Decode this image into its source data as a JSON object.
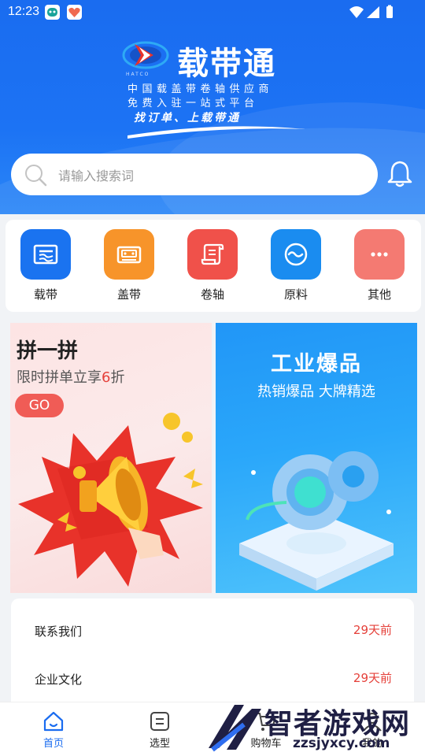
{
  "status_bar": {
    "time": "12:23"
  },
  "header": {
    "brand_name": "载带通",
    "logo_sub": "HATCO",
    "tagline_line1": "中国载盖带卷轴供应商",
    "tagline_line2": "免费入驻一站式平台",
    "slogan": "找订单、上载带通"
  },
  "search": {
    "placeholder": "请输入搜索词"
  },
  "categories": [
    {
      "label": "载带",
      "color": "#1a73f0",
      "icon": "tape-icon"
    },
    {
      "label": "盖带",
      "color": "#f7942a",
      "icon": "cassette-icon"
    },
    {
      "label": "卷轴",
      "color": "#f0514a",
      "icon": "scroll-icon"
    },
    {
      "label": "原料",
      "color": "#1a8cf0",
      "icon": "material-icon"
    },
    {
      "label": "其他",
      "color": "#f47a72",
      "icon": "more-icon"
    }
  ],
  "promo_left": {
    "title": "拼一拼",
    "subtitle_prefix": "限时拼单立享",
    "subtitle_highlight": "6",
    "subtitle_suffix": "折",
    "button": "GO"
  },
  "promo_right": {
    "title": "工业爆品",
    "subtitle": "热销爆品 大牌精选"
  },
  "news": [
    {
      "title": "联系我们",
      "time": "29天前"
    },
    {
      "title": "企业文化",
      "time": "29天前"
    }
  ],
  "tabbar": [
    {
      "label": "首页",
      "icon": "home-icon",
      "active": true
    },
    {
      "label": "选型",
      "icon": "select-icon",
      "active": false
    },
    {
      "label": "购物车",
      "icon": "cart-icon",
      "active": false
    },
    {
      "label": "我的",
      "icon": "user-icon",
      "active": false
    }
  ],
  "watermark": {
    "text": "智者游戏网",
    "url": "zzsjyxcy.com"
  }
}
